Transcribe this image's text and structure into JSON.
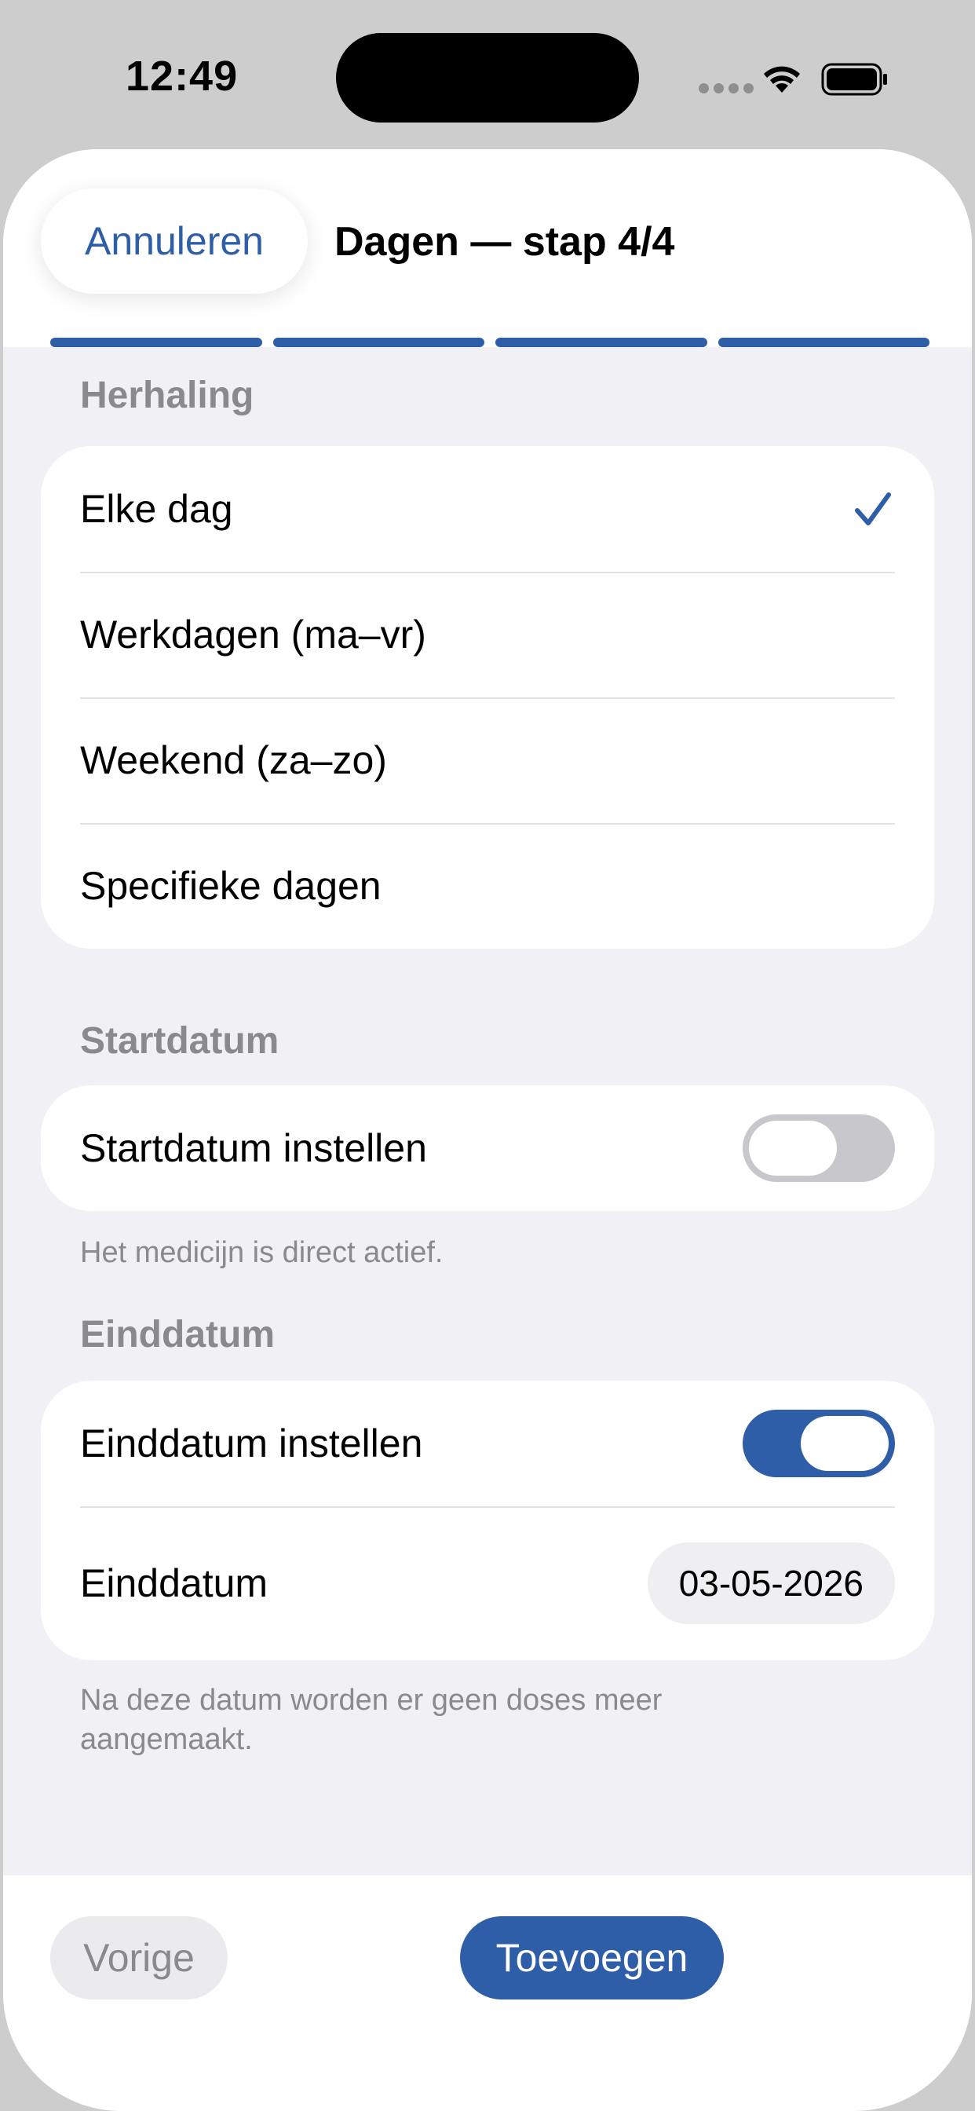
{
  "status_bar": {
    "time": "12:49"
  },
  "header": {
    "cancel_label": "Annuleren",
    "title": "Dagen — stap 4/4",
    "progress": {
      "current_step": 4,
      "total_steps": 4
    }
  },
  "repeat": {
    "section_label": "Herhaling",
    "options": [
      {
        "label": "Elke dag",
        "selected": true
      },
      {
        "label": "Werkdagen (ma–vr)",
        "selected": false
      },
      {
        "label": "Weekend (za–zo)",
        "selected": false
      },
      {
        "label": "Specifieke dagen",
        "selected": false
      }
    ]
  },
  "start_date": {
    "section_label": "Startdatum",
    "toggle_label": "Startdatum instellen",
    "toggle_on": false,
    "footnote": "Het medicijn is direct actief."
  },
  "end_date": {
    "section_label": "Einddatum",
    "toggle_label": "Einddatum instellen",
    "toggle_on": true,
    "date_label": "Einddatum",
    "date_value": "03-05-2026",
    "footnote": "Na deze datum worden er geen doses meer aangemaakt."
  },
  "footer": {
    "prev_label": "Vorige",
    "add_label": "Toevoegen"
  },
  "colors": {
    "accent": "#2f5ea8",
    "background": "#f1f1f5",
    "secondary_text": "#8a8a8e"
  }
}
